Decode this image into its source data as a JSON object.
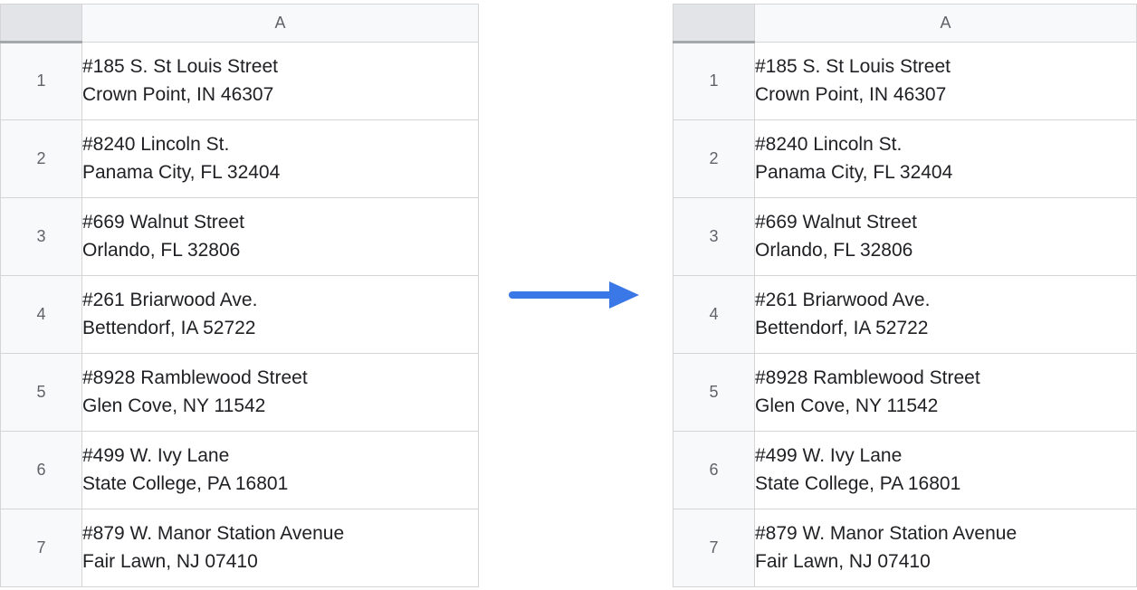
{
  "left_sheet": {
    "column_label": "A",
    "rows": [
      {
        "num": "1",
        "line1": "#185  S.   St Louis Street",
        "line2": "Crown Point,   IN 46307"
      },
      {
        "num": "2",
        "line1": "#8240  Lincoln St.",
        "line2": "Panama   City,   FL 32404"
      },
      {
        "num": "3",
        "line1": "#669 Walnut   Street",
        "line2": "Orlando,   FL 32806"
      },
      {
        "num": "4",
        "line1": "#261 Briarwood   Ave.",
        "line2": "Bettendorf,   IA 52722"
      },
      {
        "num": "5",
        "line1": "#8928 Ramblewood Street",
        "line2": "Glen   Cove,   NY 11542"
      },
      {
        "num": "6",
        "line1": "#499   W. Ivy   Lane",
        "line2": "State College,   PA 16801"
      },
      {
        "num": "7",
        "line1": "#879   W. Manor Station Avenue",
        "line2": "Fair Lawn,   NJ 07410"
      }
    ]
  },
  "right_sheet": {
    "column_label": "A",
    "rows": [
      {
        "num": "1",
        "line1": "#185 S. St Louis Street",
        "line2": "Crown Point, IN 46307"
      },
      {
        "num": "2",
        "line1": "#8240 Lincoln St.",
        "line2": "Panama City, FL 32404"
      },
      {
        "num": "3",
        "line1": "#669 Walnut Street",
        "line2": "Orlando, FL 32806"
      },
      {
        "num": "4",
        "line1": "#261 Briarwood Ave.",
        "line2": "Bettendorf, IA 52722"
      },
      {
        "num": "5",
        "line1": "#8928 Ramblewood Street",
        "line2": "Glen Cove, NY 11542"
      },
      {
        "num": "6",
        "line1": "#499 W. Ivy Lane",
        "line2": "State College, PA 16801"
      },
      {
        "num": "7",
        "line1": "#879 W. Manor Station Avenue",
        "line2": "Fair Lawn, NJ 07410"
      }
    ]
  },
  "arrow_color": "#3b78e7"
}
